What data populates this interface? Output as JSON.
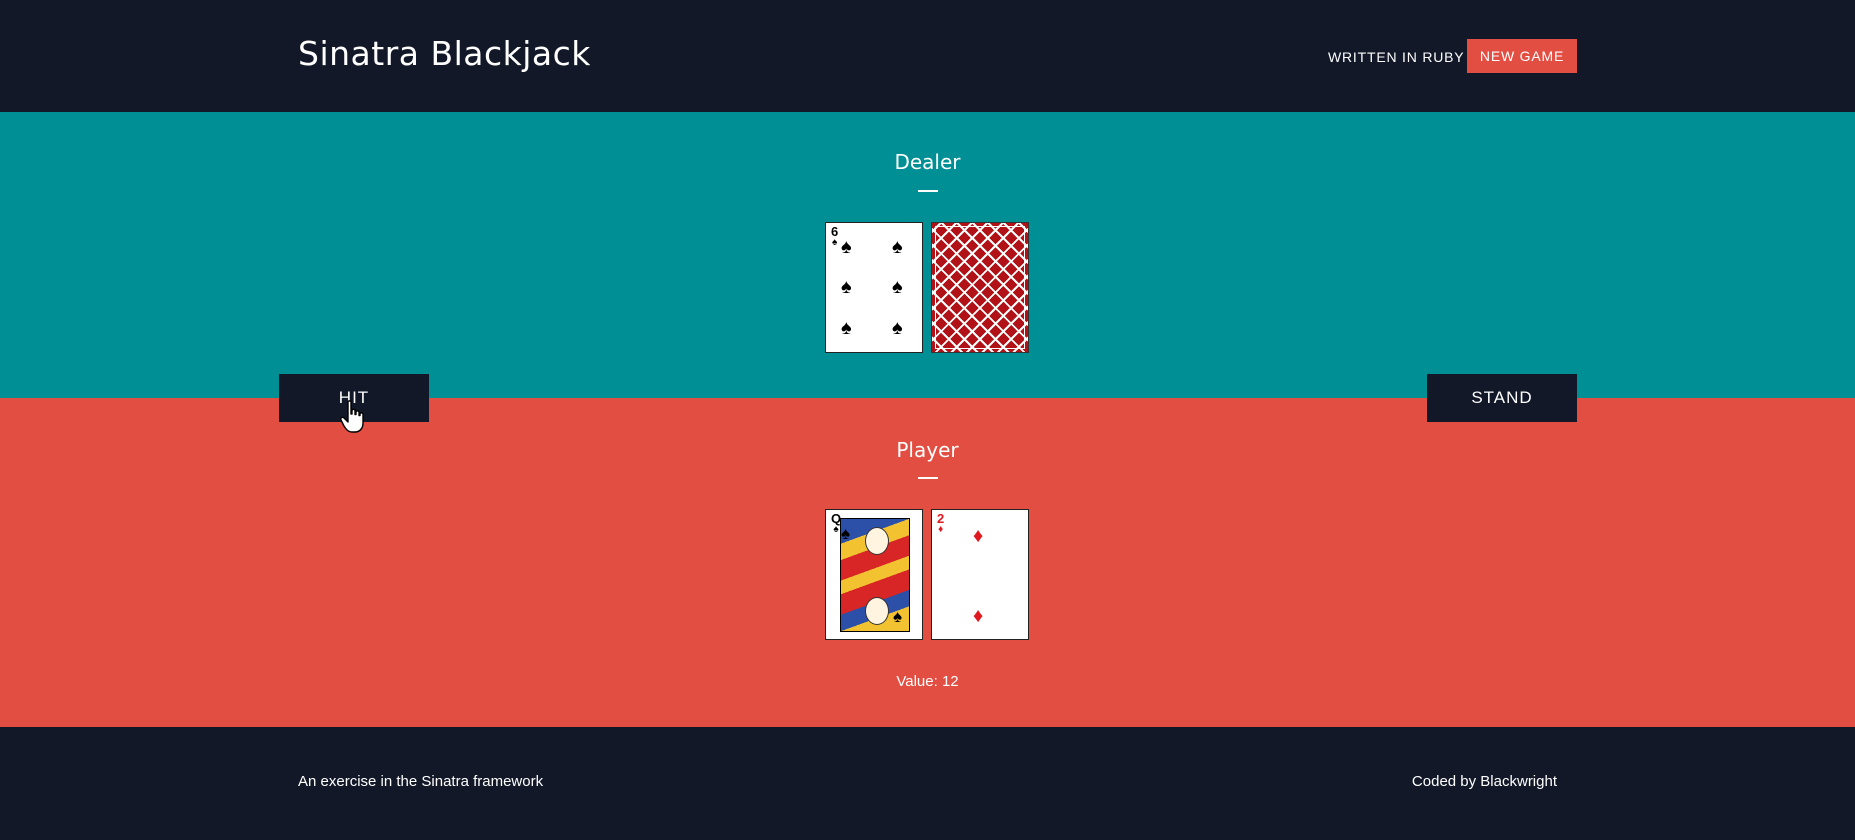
{
  "header": {
    "brand": "Sinatra Blackjack",
    "nav_link": "WRITTEN IN RUBY",
    "new_game_label": "NEW GAME"
  },
  "dealer": {
    "title": "Dealer",
    "cards": [
      {
        "rank": "6",
        "suit": "spades",
        "suit_symbol": "♠",
        "face_up": true
      },
      {
        "face_up": false,
        "back": "card-back-red"
      }
    ]
  },
  "player": {
    "title": "Player",
    "cards": [
      {
        "rank": "Q",
        "suit": "spades",
        "suit_symbol": "♠",
        "face_up": true
      },
      {
        "rank": "2",
        "suit": "diamonds",
        "suit_symbol": "♦",
        "face_up": true
      }
    ],
    "value_text": "Value: 12"
  },
  "actions": {
    "hit_label": "HIT",
    "stand_label": "STAND"
  },
  "footer": {
    "left": "An exercise in the Sinatra framework",
    "right": "Coded by Blackwright"
  },
  "colors": {
    "navy": "#121828",
    "teal": "#008f95",
    "coral": "#e24e42",
    "card_red": "#e0191e"
  },
  "icons": {
    "cursor": "hand-pointer-icon"
  }
}
